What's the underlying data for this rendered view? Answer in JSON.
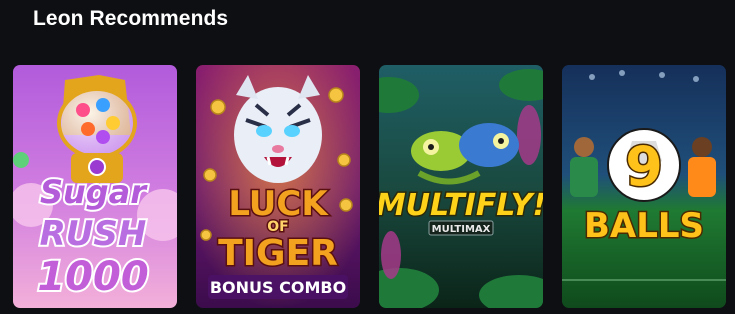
{
  "section": {
    "title": "Leon Recommends"
  },
  "games": [
    {
      "id": "sugar-rush",
      "logo_lines": [
        "Sugar",
        "RUSH",
        "1000"
      ],
      "colors": {
        "bg_top": "#b85de0",
        "bg_bottom": "#f2a4d6",
        "text": "#b35bd9",
        "outline": "#ffffff"
      }
    },
    {
      "id": "luck-of-tiger",
      "logo_lines": [
        "LUCK",
        "OF",
        "TIGER"
      ],
      "subtitle": "BONUS COMBO",
      "colors": {
        "bg_top": "#7a1a7a",
        "bg_bottom": "#3a0b4a",
        "text": "#f2a21e",
        "subtitle_bg": "#5a1570"
      }
    },
    {
      "id": "multifly",
      "logo_lines": [
        "MULTIFLY!"
      ],
      "badge": "MULTIMAX",
      "colors": {
        "bg_top": "#1d5a5a",
        "bg_bottom": "#0e2c20",
        "text": "#ffd21a"
      }
    },
    {
      "id": "9-balls",
      "logo_lines": [
        "9",
        "BALLS"
      ],
      "colors": {
        "bg_top": "#1a3a66",
        "bg_bottom": "#1e7a2a",
        "text": "#ffc21a"
      }
    }
  ]
}
